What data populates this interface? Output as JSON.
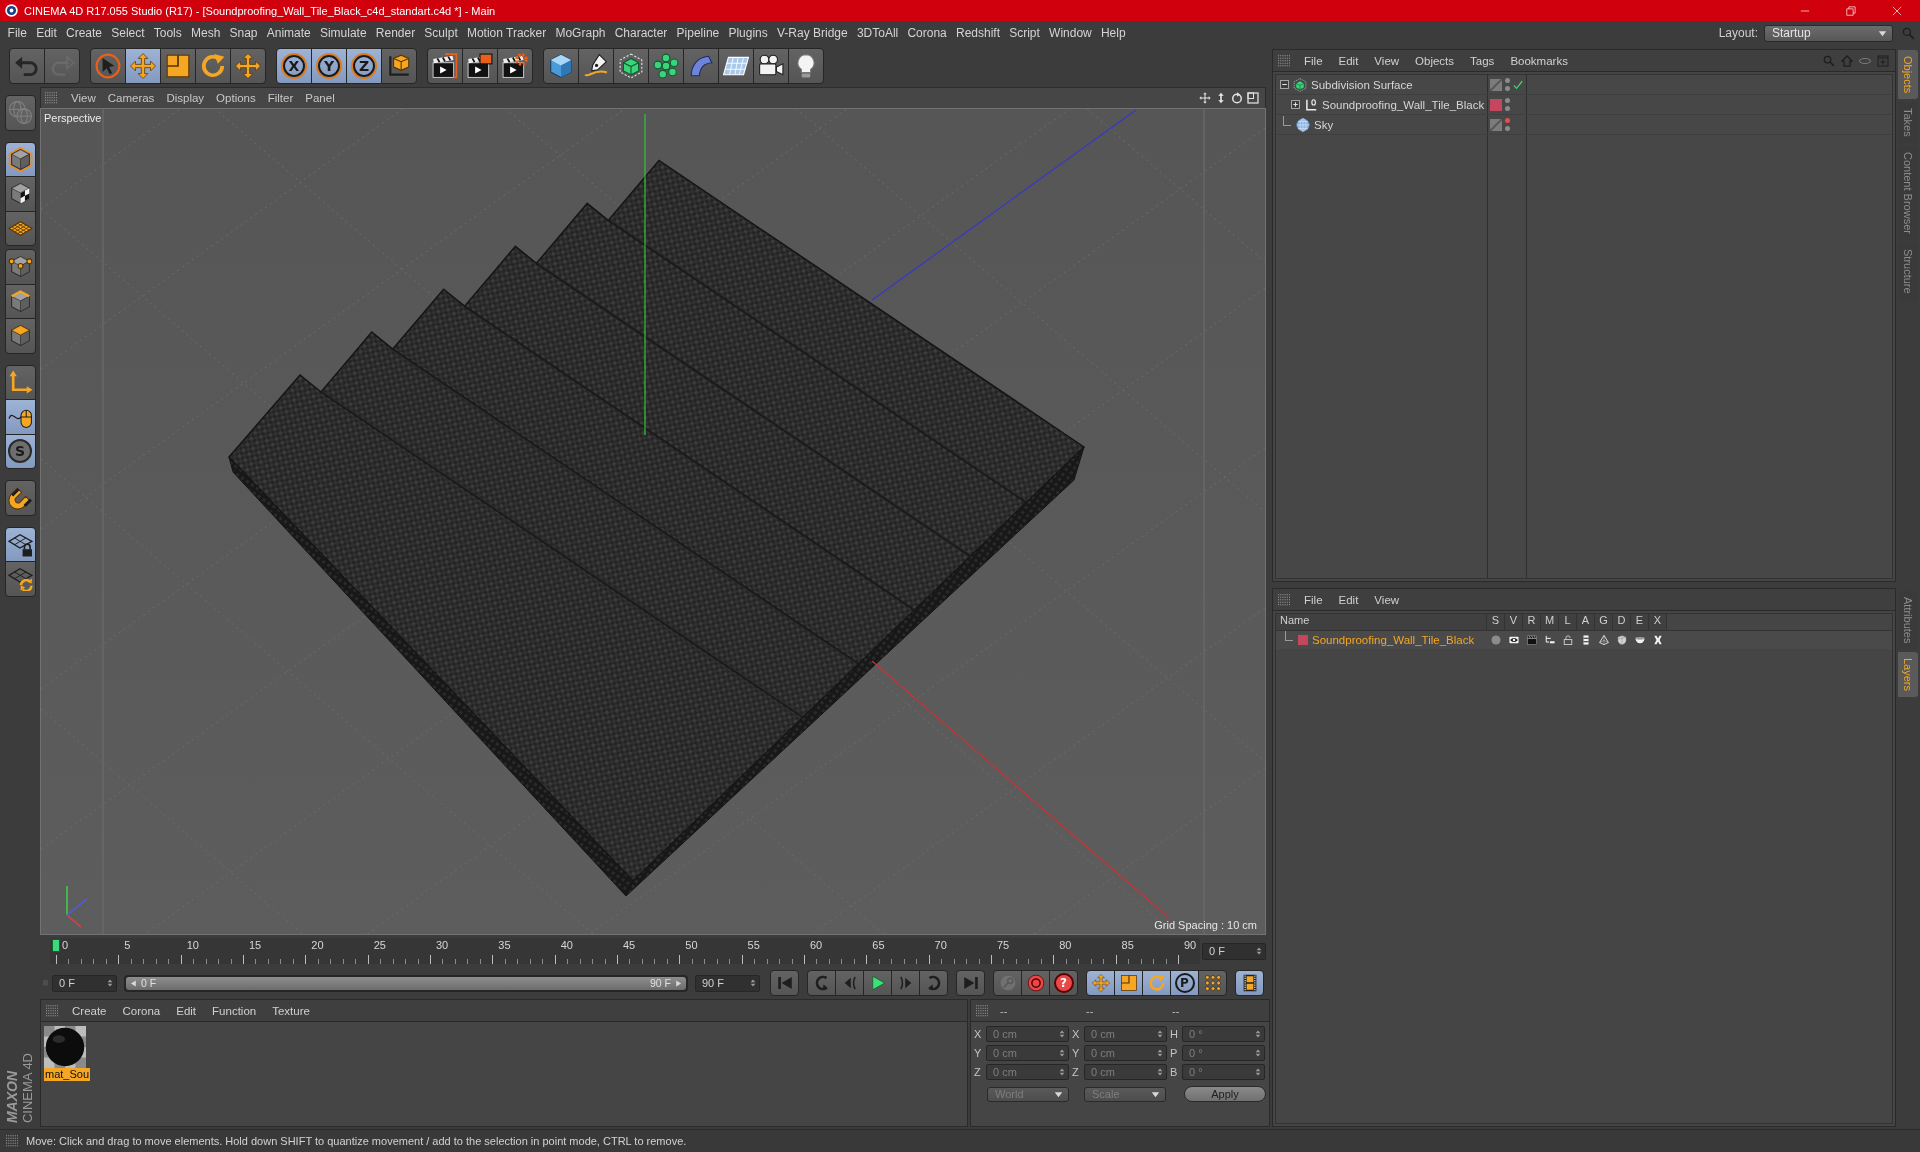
{
  "window": {
    "title": "CINEMA 4D R17.055 Studio (R17) - [Soundproofing_Wall_Tile_Black_c4d_standart.c4d *] - Main"
  },
  "menu": [
    "File",
    "Edit",
    "Create",
    "Select",
    "Tools",
    "Mesh",
    "Snap",
    "Animate",
    "Simulate",
    "Render",
    "Sculpt",
    "Motion Tracker",
    "MoGraph",
    "Character",
    "Pipeline",
    "Plugins",
    "V-Ray Bridge",
    "3DToAll",
    "Corona",
    "Redshift",
    "Script",
    "Window",
    "Help"
  ],
  "layout": {
    "label": "Layout:",
    "value": "Startup"
  },
  "toolbar": [
    [
      {
        "kind": "undo",
        "active": false,
        "disabled": false
      },
      {
        "kind": "redo",
        "active": false,
        "disabled": true
      }
    ],
    [
      {
        "kind": "selection-tool",
        "active": false,
        "disabled": false
      },
      {
        "kind": "move-tool",
        "active": true,
        "disabled": false
      },
      {
        "kind": "scale-tool",
        "active": false,
        "disabled": false
      },
      {
        "kind": "rotate-tool",
        "active": false,
        "disabled": false
      },
      {
        "kind": "recent-tool",
        "active": false,
        "disabled": false
      }
    ],
    [
      {
        "kind": "axis-lock",
        "label": "X",
        "active": true,
        "disabled": false
      },
      {
        "kind": "axis-lock",
        "label": "Y",
        "active": true,
        "disabled": false
      },
      {
        "kind": "axis-lock",
        "label": "Z",
        "active": true,
        "disabled": false
      },
      {
        "kind": "coordinate-system",
        "active": false,
        "disabled": false
      }
    ],
    [
      {
        "kind": "render-view",
        "active": false,
        "disabled": false
      },
      {
        "kind": "render-to-viewer",
        "active": false,
        "disabled": false
      },
      {
        "kind": "render-settings",
        "active": false,
        "disabled": false
      }
    ],
    [
      {
        "kind": "cube",
        "active": false,
        "disabled": false
      },
      {
        "kind": "spline-pen",
        "active": false,
        "disabled": false
      },
      {
        "kind": "subdivision-surface",
        "active": false,
        "disabled": false
      },
      {
        "kind": "cloner",
        "active": false,
        "disabled": false
      },
      {
        "kind": "bend-deformer",
        "active": false,
        "disabled": false
      },
      {
        "kind": "floor",
        "active": false,
        "disabled": false
      },
      {
        "kind": "camera",
        "active": false,
        "disabled": false
      },
      {
        "kind": "light",
        "active": false,
        "disabled": false
      }
    ]
  ],
  "tools": [
    [
      {
        "kind": "make-editable",
        "active": false,
        "disabled": true
      }
    ],
    [
      {
        "kind": "model-mode",
        "active": true,
        "disabled": false
      },
      {
        "kind": "texture-mode",
        "active": false,
        "disabled": false
      },
      {
        "kind": "workplane-mode",
        "active": false,
        "disabled": false
      }
    ],
    [
      {
        "kind": "points-mode",
        "active": false,
        "disabled": false
      },
      {
        "kind": "edges-mode",
        "active": false,
        "disabled": false
      },
      {
        "kind": "polygons-mode",
        "active": false,
        "disabled": false
      }
    ],
    [
      {
        "kind": "axis-mode",
        "active": false,
        "disabled": false
      },
      {
        "kind": "tweak-mode",
        "active": true,
        "disabled": false
      },
      {
        "kind": "snap",
        "label": "S",
        "active": true,
        "disabled": false
      }
    ],
    [
      {
        "kind": "magnet",
        "active": false,
        "disabled": false
      }
    ],
    [
      {
        "kind": "lock-workplane",
        "active": true,
        "disabled": false
      },
      {
        "kind": "planar-workplane",
        "active": false,
        "disabled": false
      }
    ]
  ],
  "viewport": {
    "menu": [
      "View",
      "Cameras",
      "Display",
      "Options",
      "Filter",
      "Panel"
    ],
    "camera": "Perspective",
    "grid_spacing": "Grid Spacing : 10 cm"
  },
  "timeline": {
    "ticks": [
      "0",
      "5",
      "10",
      "15",
      "20",
      "25",
      "30",
      "35",
      "40",
      "45",
      "50",
      "55",
      "60",
      "65",
      "70",
      "75",
      "80",
      "85",
      "90"
    ],
    "level": 0,
    "current_frame": "0 F"
  },
  "transport": {
    "start": "0 F",
    "range": {
      "start": "0 F",
      "end": "90 F",
      "level": 1
    },
    "end": "90 F",
    "buttons": [
      [
        {
          "kind": "go-to-start",
          "active": false,
          "disabled": false
        }
      ],
      [
        {
          "kind": "previous-key",
          "active": false,
          "disabled": false
        },
        {
          "kind": "previous-frame",
          "active": false,
          "disabled": false
        },
        {
          "kind": "play",
          "active": false,
          "disabled": false
        },
        {
          "kind": "next-frame",
          "active": false,
          "disabled": false
        },
        {
          "kind": "next-key",
          "active": false,
          "disabled": false
        }
      ],
      [
        {
          "kind": "go-to-end",
          "active": false,
          "disabled": false
        }
      ],
      [
        {
          "kind": "record",
          "active": false,
          "disabled": true
        },
        {
          "kind": "autokey",
          "active": false,
          "disabled": false
        },
        {
          "kind": "keyframe-selection",
          "label": "?",
          "active": false,
          "disabled": false
        }
      ],
      [
        {
          "kind": "key-position",
          "active": true,
          "disabled": false
        },
        {
          "kind": "key-scale",
          "active": true,
          "disabled": false
        },
        {
          "kind": "key-rotation",
          "active": true,
          "disabled": false
        },
        {
          "kind": "point-level",
          "label": "P",
          "active": true,
          "disabled": false
        },
        {
          "kind": "parameter",
          "active": false,
          "disabled": false
        }
      ],
      [
        {
          "kind": "timeline",
          "active": true,
          "disabled": false
        }
      ]
    ]
  },
  "materials": {
    "menu": [
      "Create",
      "Corona",
      "Edit",
      "Function",
      "Texture"
    ],
    "items": [
      {
        "name": "mat_Sou",
        "selected": true
      }
    ]
  },
  "coordinates": {
    "headers": [
      "--",
      "--",
      "--"
    ],
    "rows": [
      {
        "axis": "X",
        "position": "0 cm",
        "size_axis": "X",
        "size": "0 cm",
        "rotation_axis": "H",
        "rotation": "0 °"
      },
      {
        "axis": "Y",
        "position": "0 cm",
        "size_axis": "Y",
        "size": "0 cm",
        "rotation_axis": "P",
        "rotation": "0 °"
      },
      {
        "axis": "Z",
        "position": "0 cm",
        "size_axis": "Z",
        "size": "0 cm",
        "rotation_axis": "B",
        "rotation": "0 °"
      }
    ],
    "disabled": true,
    "coordinate_system": "World",
    "mode": "Scale",
    "apply": "Apply"
  },
  "objects": {
    "menu": [
      "File",
      "Edit",
      "View",
      "Objects",
      "Tags",
      "Bookmarks"
    ],
    "tree": [
      {
        "kind": "subdivision",
        "name": "Subdivision Surface",
        "expanded": true,
        "check": true,
        "editor_hidden": false,
        "render_hidden": false,
        "children": [
          {
            "kind": "null",
            "name": "Soundproofing_Wall_Tile_Black",
            "expanded": false,
            "check": false,
            "editor_hidden": false,
            "render_hidden": false,
            "color": "#c4475e"
          }
        ]
      },
      {
        "kind": "sky",
        "name": "Sky",
        "check": false,
        "editor_hidden": true,
        "render_hidden": false
      }
    ]
  },
  "layers": {
    "menu": [
      "File",
      "Edit",
      "View"
    ],
    "columns": [
      "Name",
      "S",
      "V",
      "R",
      "M",
      "L",
      "A",
      "G",
      "D",
      "E",
      "X"
    ],
    "rows": [
      {
        "name": "Soundproofing_Wall_Tile_Black",
        "color": "#c4475e",
        "selected": true
      }
    ]
  },
  "side_tabs": {
    "top": [
      {
        "label": "Objects",
        "selected": true
      },
      {
        "label": "Takes",
        "selected": false
      },
      {
        "label": "Content Browser",
        "selected": false
      },
      {
        "label": "Structure",
        "selected": false
      }
    ],
    "bottom": [
      {
        "label": "Attributes",
        "selected": false
      },
      {
        "label": "Layers",
        "selected": true
      }
    ]
  },
  "logo": {
    "brand": "MAXON",
    "product": "CINEMA 4D"
  },
  "status_bar": "Move: Click and drag to move elements. Hold down SHIFT to quantize movement / add to the selection in point mode, CTRL to remove."
}
